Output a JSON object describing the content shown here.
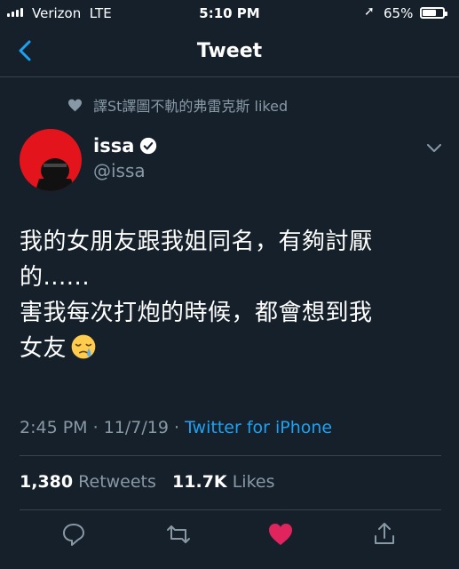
{
  "status_bar": {
    "carrier": "Verizon",
    "network": "LTE",
    "time": "5:10 PM",
    "battery": "65%",
    "battery_level": 0.65
  },
  "header": {
    "title": "Tweet"
  },
  "social_context": {
    "liked_text": "譯St譯圖不軌的弗雷克斯 liked"
  },
  "author": {
    "name": "issa",
    "handle": "@issa",
    "verified": true
  },
  "tweet": {
    "lines": [
      "我的女朋友跟我姐同名，有夠討厭",
      "的......",
      "害我每次打炮的時候，都會想到我",
      "女友"
    ],
    "emoji": "sleepy-face",
    "time": "2:45 PM",
    "date": "11/7/19",
    "source": "Twitter for iPhone"
  },
  "stats": {
    "retweets_count": "1,380",
    "retweets_label": "Retweets",
    "likes_count": "11.7K",
    "likes_label": "Likes"
  },
  "colors": {
    "background": "#15202b",
    "secondary_text": "#8899a6",
    "accent": "#1da1f2",
    "like": "#e0245e",
    "divider": "#38444d"
  }
}
